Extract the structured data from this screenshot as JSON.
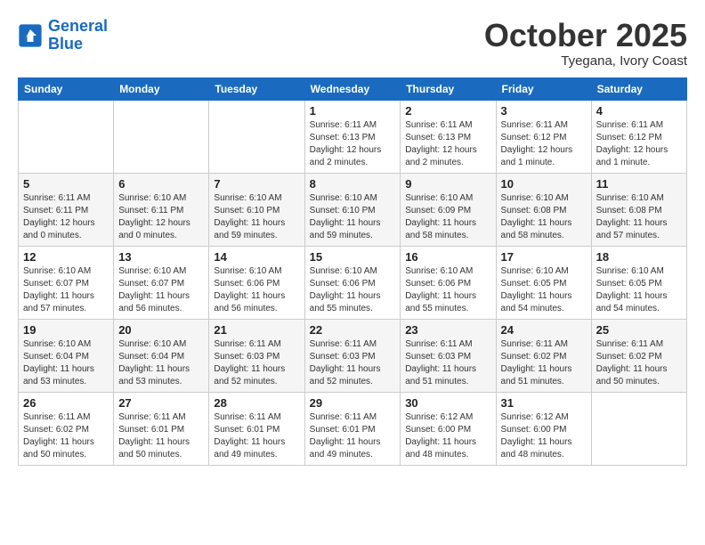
{
  "header": {
    "logo_line1": "General",
    "logo_line2": "Blue",
    "month": "October 2025",
    "location": "Tyegana, Ivory Coast"
  },
  "weekdays": [
    "Sunday",
    "Monday",
    "Tuesday",
    "Wednesday",
    "Thursday",
    "Friday",
    "Saturday"
  ],
  "weeks": [
    [
      {
        "day": "",
        "info": ""
      },
      {
        "day": "",
        "info": ""
      },
      {
        "day": "",
        "info": ""
      },
      {
        "day": "1",
        "info": "Sunrise: 6:11 AM\nSunset: 6:13 PM\nDaylight: 12 hours and 2 minutes."
      },
      {
        "day": "2",
        "info": "Sunrise: 6:11 AM\nSunset: 6:13 PM\nDaylight: 12 hours and 2 minutes."
      },
      {
        "day": "3",
        "info": "Sunrise: 6:11 AM\nSunset: 6:12 PM\nDaylight: 12 hours and 1 minute."
      },
      {
        "day": "4",
        "info": "Sunrise: 6:11 AM\nSunset: 6:12 PM\nDaylight: 12 hours and 1 minute."
      }
    ],
    [
      {
        "day": "5",
        "info": "Sunrise: 6:11 AM\nSunset: 6:11 PM\nDaylight: 12 hours and 0 minutes."
      },
      {
        "day": "6",
        "info": "Sunrise: 6:10 AM\nSunset: 6:11 PM\nDaylight: 12 hours and 0 minutes."
      },
      {
        "day": "7",
        "info": "Sunrise: 6:10 AM\nSunset: 6:10 PM\nDaylight: 11 hours and 59 minutes."
      },
      {
        "day": "8",
        "info": "Sunrise: 6:10 AM\nSunset: 6:10 PM\nDaylight: 11 hours and 59 minutes."
      },
      {
        "day": "9",
        "info": "Sunrise: 6:10 AM\nSunset: 6:09 PM\nDaylight: 11 hours and 58 minutes."
      },
      {
        "day": "10",
        "info": "Sunrise: 6:10 AM\nSunset: 6:08 PM\nDaylight: 11 hours and 58 minutes."
      },
      {
        "day": "11",
        "info": "Sunrise: 6:10 AM\nSunset: 6:08 PM\nDaylight: 11 hours and 57 minutes."
      }
    ],
    [
      {
        "day": "12",
        "info": "Sunrise: 6:10 AM\nSunset: 6:07 PM\nDaylight: 11 hours and 57 minutes."
      },
      {
        "day": "13",
        "info": "Sunrise: 6:10 AM\nSunset: 6:07 PM\nDaylight: 11 hours and 56 minutes."
      },
      {
        "day": "14",
        "info": "Sunrise: 6:10 AM\nSunset: 6:06 PM\nDaylight: 11 hours and 56 minutes."
      },
      {
        "day": "15",
        "info": "Sunrise: 6:10 AM\nSunset: 6:06 PM\nDaylight: 11 hours and 55 minutes."
      },
      {
        "day": "16",
        "info": "Sunrise: 6:10 AM\nSunset: 6:06 PM\nDaylight: 11 hours and 55 minutes."
      },
      {
        "day": "17",
        "info": "Sunrise: 6:10 AM\nSunset: 6:05 PM\nDaylight: 11 hours and 54 minutes."
      },
      {
        "day": "18",
        "info": "Sunrise: 6:10 AM\nSunset: 6:05 PM\nDaylight: 11 hours and 54 minutes."
      }
    ],
    [
      {
        "day": "19",
        "info": "Sunrise: 6:10 AM\nSunset: 6:04 PM\nDaylight: 11 hours and 53 minutes."
      },
      {
        "day": "20",
        "info": "Sunrise: 6:10 AM\nSunset: 6:04 PM\nDaylight: 11 hours and 53 minutes."
      },
      {
        "day": "21",
        "info": "Sunrise: 6:11 AM\nSunset: 6:03 PM\nDaylight: 11 hours and 52 minutes."
      },
      {
        "day": "22",
        "info": "Sunrise: 6:11 AM\nSunset: 6:03 PM\nDaylight: 11 hours and 52 minutes."
      },
      {
        "day": "23",
        "info": "Sunrise: 6:11 AM\nSunset: 6:03 PM\nDaylight: 11 hours and 51 minutes."
      },
      {
        "day": "24",
        "info": "Sunrise: 6:11 AM\nSunset: 6:02 PM\nDaylight: 11 hours and 51 minutes."
      },
      {
        "day": "25",
        "info": "Sunrise: 6:11 AM\nSunset: 6:02 PM\nDaylight: 11 hours and 50 minutes."
      }
    ],
    [
      {
        "day": "26",
        "info": "Sunrise: 6:11 AM\nSunset: 6:02 PM\nDaylight: 11 hours and 50 minutes."
      },
      {
        "day": "27",
        "info": "Sunrise: 6:11 AM\nSunset: 6:01 PM\nDaylight: 11 hours and 50 minutes."
      },
      {
        "day": "28",
        "info": "Sunrise: 6:11 AM\nSunset: 6:01 PM\nDaylight: 11 hours and 49 minutes."
      },
      {
        "day": "29",
        "info": "Sunrise: 6:11 AM\nSunset: 6:01 PM\nDaylight: 11 hours and 49 minutes."
      },
      {
        "day": "30",
        "info": "Sunrise: 6:12 AM\nSunset: 6:00 PM\nDaylight: 11 hours and 48 minutes."
      },
      {
        "day": "31",
        "info": "Sunrise: 6:12 AM\nSunset: 6:00 PM\nDaylight: 11 hours and 48 minutes."
      },
      {
        "day": "",
        "info": ""
      }
    ]
  ]
}
